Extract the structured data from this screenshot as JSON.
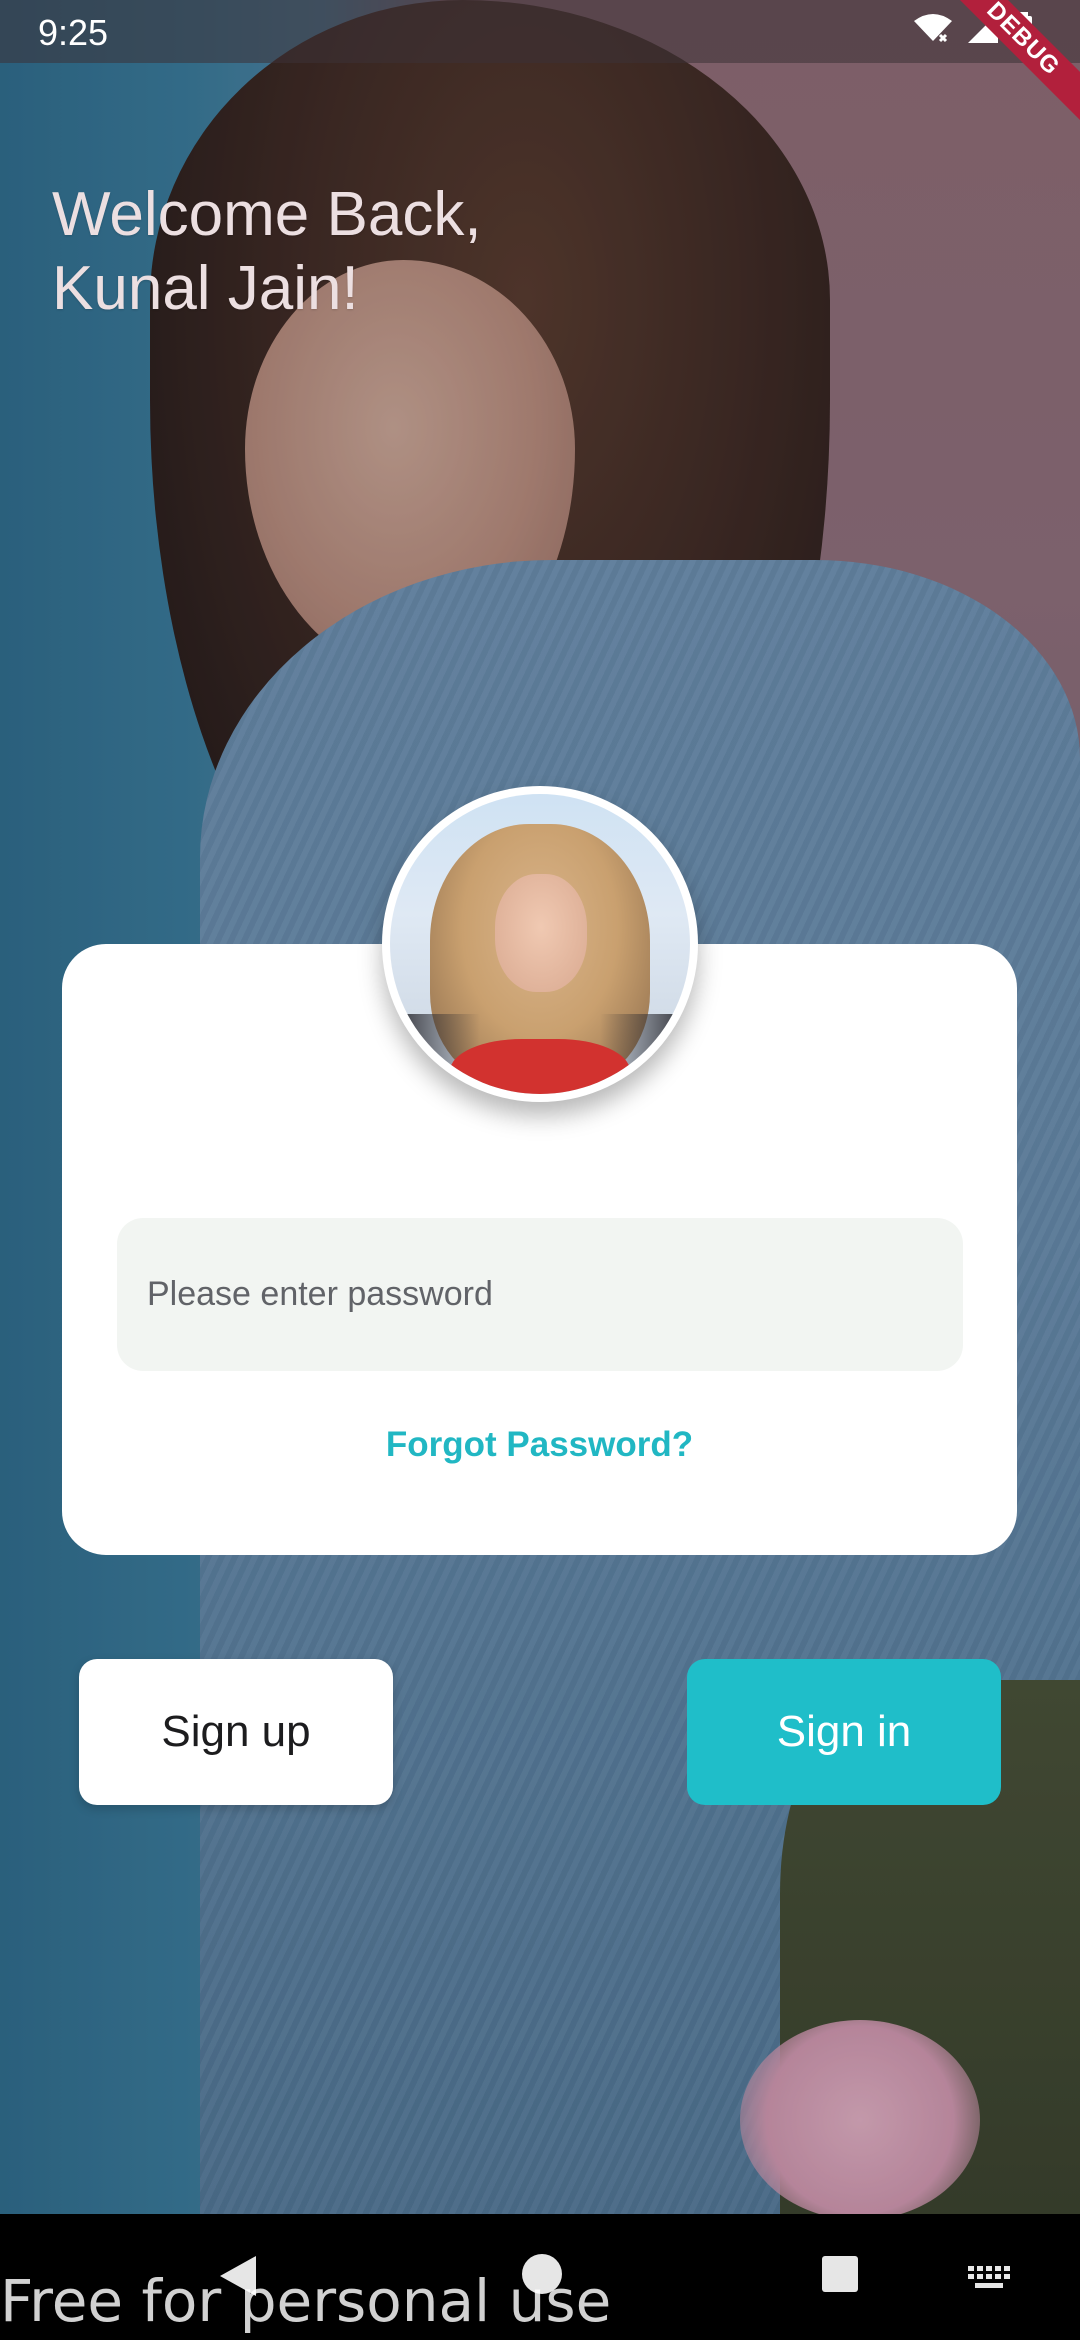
{
  "status_bar": {
    "time": "9:25",
    "icons": [
      "wifi-icon",
      "signal-icon",
      "battery-icon"
    ],
    "debug_banner": "DEBUG"
  },
  "header": {
    "welcome_line1": "Welcome Back,",
    "welcome_line2": "Kunal Jain!"
  },
  "login_card": {
    "avatar": "profile-avatar",
    "password_placeholder": "Please enter password",
    "password_value": "",
    "forgot_label": "Forgot Password?"
  },
  "actions": {
    "signup_label": "Sign up",
    "signin_label": "Sign in"
  },
  "nav_bar": {
    "icons": [
      "back-icon",
      "home-icon",
      "recents-icon",
      "keyboard-icon"
    ],
    "watermark": "Free for personal use"
  },
  "colors": {
    "accent": "#21b7c3",
    "signin_bg": "#1fbec9",
    "field_bg": "#f2f5f2",
    "debug_red": "#b2203c"
  }
}
